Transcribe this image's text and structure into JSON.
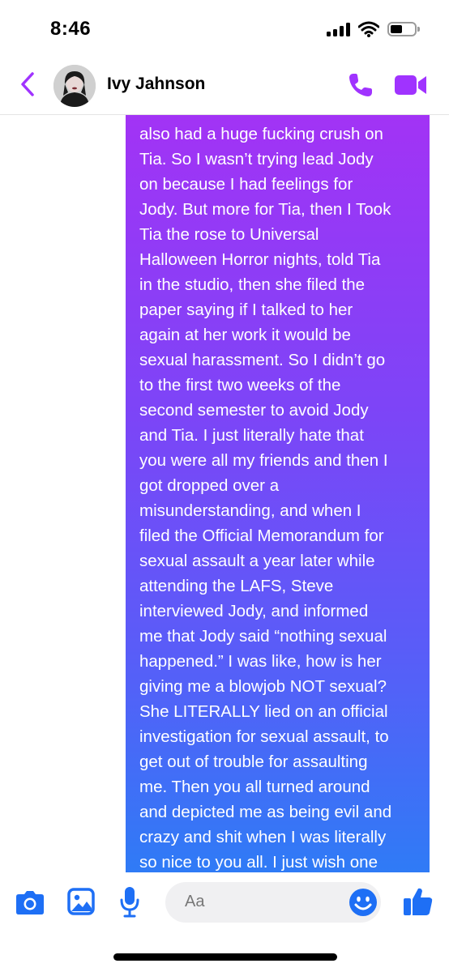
{
  "status": {
    "time": "8:46"
  },
  "header": {
    "contact_name": "Ivy Jahnson"
  },
  "message": {
    "lines": [
      "also had a huge fucking crush on",
      "Tia. So I wasn’t trying lead Jody",
      "on because I had feelings for",
      "Jody. But more for Tia, then I Took",
      "Tia the rose to Universal",
      "Halloween Horror nights, told Tia",
      "in the studio, then she filed the",
      "paper saying if I talked to her",
      "again at her work it would be",
      "sexual harassment. So I didn’t go",
      "to the first two weeks of the",
      "second semester to avoid Jody",
      "and Tia. I just literally hate that",
      "you were all my friends and then I",
      "got dropped over a",
      "misunderstanding, and when I",
      "filed the Official Memorandum for",
      "sexual assault a year later while",
      "attending the LAFS, Steve",
      "interviewed Jody, and informed",
      "me that Jody said “nothing sexual",
      "happened.” I was like, how is her",
      "giving me a blowjob NOT sexual?",
      "She LITERALLY lied on an official",
      "investigation for sexual assault, to",
      "get out of trouble for assaulting",
      "me. Then you all turned around",
      "and depicted me as being evil and",
      "crazy and shit when I was literally",
      "so nice to you all. I just wish one"
    ]
  },
  "composer": {
    "placeholder": "Aa"
  },
  "colors": {
    "accent": "#a033ff",
    "composer_blue": "#1e6ff5",
    "bubble_top": "#a233f5",
    "bubble_bottom": "#2f7bf6"
  }
}
